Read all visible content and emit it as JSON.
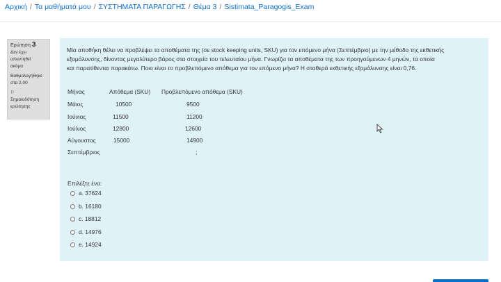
{
  "breadcrumb": {
    "home": "Αρχική",
    "my_courses": "Τα μαθήματά μου",
    "course": "ΣΥΣΤΗΜΑΤΑ ΠΑΡΑΓΩΓΗΣ",
    "topic": "Θέμα 3",
    "quiz": "Sistimata_Paragogis_Exam"
  },
  "info": {
    "question_label": "Ερώτηση",
    "question_number": "3",
    "state_1": "Δεν έχει",
    "state_2": "απαντηθεί",
    "state_3": "ακόμα",
    "grade_1": "Βαθμολογήθηκε",
    "grade_2": "στα 2,00",
    "flag_icon_char": "⚐",
    "flag_1": "Σημαιοδότηση",
    "flag_2": "ερώτησης"
  },
  "question": {
    "line1": "Μία αποθήκη θέλει να προβλέψει τα αποθέματα της (σε stock keeping units, SKU) για τον επόμενο μήνα (Σεπτέμβριο) με την μέθοδο της εκθετικής",
    "line2": "εξομάλυνσης, δίνοντας μεγαλύτερο βάρος στα στοιχεία του τελευταίου μήνα. Γνωρίζει τα αποθέματα  της των προηγούμενων 4 μηνών, τα οποία",
    "line3": "και παρατίθενται παρακάτω. Ποιο είναι το προβλεπόμενο απόθεμα για τον επόμενο μήνα?  Η σταθερά εκθετικής εξομάλυνσης είναι 0,76."
  },
  "table": {
    "headers": [
      "Μήνας",
      "Απόθεμα (SKU)",
      "Προβλεπόμενο απόθεμα (SKU)"
    ],
    "rows": [
      {
        "month": "Μάιος",
        "stock": "10500",
        "forecast": "9500"
      },
      {
        "month": "Ιούνιος",
        "stock": "11500",
        "forecast": "11200"
      },
      {
        "month": "Ιούλιος",
        "stock": "12800",
        "forecast": "12600"
      },
      {
        "month": "Αύγουστος",
        "stock": "15000",
        "forecast": "14900"
      },
      {
        "month": "Σεπτέμβριος",
        "stock": "",
        "forecast": ";"
      }
    ]
  },
  "answer": {
    "prompt": "Επιλέξτε ένα:",
    "options": [
      "a. 37624",
      "b. 16180",
      "c. 18812",
      "d. 14976",
      "e. 14924"
    ]
  }
}
